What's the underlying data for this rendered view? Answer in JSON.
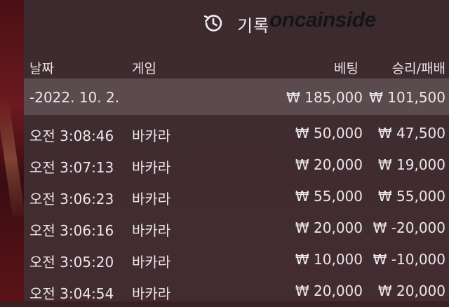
{
  "header": {
    "title": "기록",
    "watermark": "oncainside"
  },
  "columns": {
    "date": "날짜",
    "game": "게임",
    "bet": "베팅",
    "winloss": "승리/패배"
  },
  "summary": {
    "date": "-2022. 10. 2.",
    "bet": "₩ 185,000",
    "winloss": "₩ 101,500"
  },
  "rows": [
    {
      "time": "오전 3:08:46",
      "game": "바카라",
      "bet": "₩ 50,000",
      "winloss": "₩ 47,500"
    },
    {
      "time": "오전 3:07:13",
      "game": "바카라",
      "bet": "₩ 20,000",
      "winloss": "₩ 19,000"
    },
    {
      "time": "오전 3:06:23",
      "game": "바카라",
      "bet": "₩ 55,000",
      "winloss": "₩ 55,000"
    },
    {
      "time": "오전 3:06:16",
      "game": "바카라",
      "bet": "₩ 20,000",
      "winloss": "₩ -20,000"
    },
    {
      "time": "오전 3:05:20",
      "game": "바카라",
      "bet": "₩ 10,000",
      "winloss": "₩ -10,000"
    },
    {
      "time": "오전 3:04:54",
      "game": "바카라",
      "bet": "₩ 20,000",
      "winloss": "₩ 20,000"
    }
  ],
  "icons": {
    "history": "history-icon"
  }
}
